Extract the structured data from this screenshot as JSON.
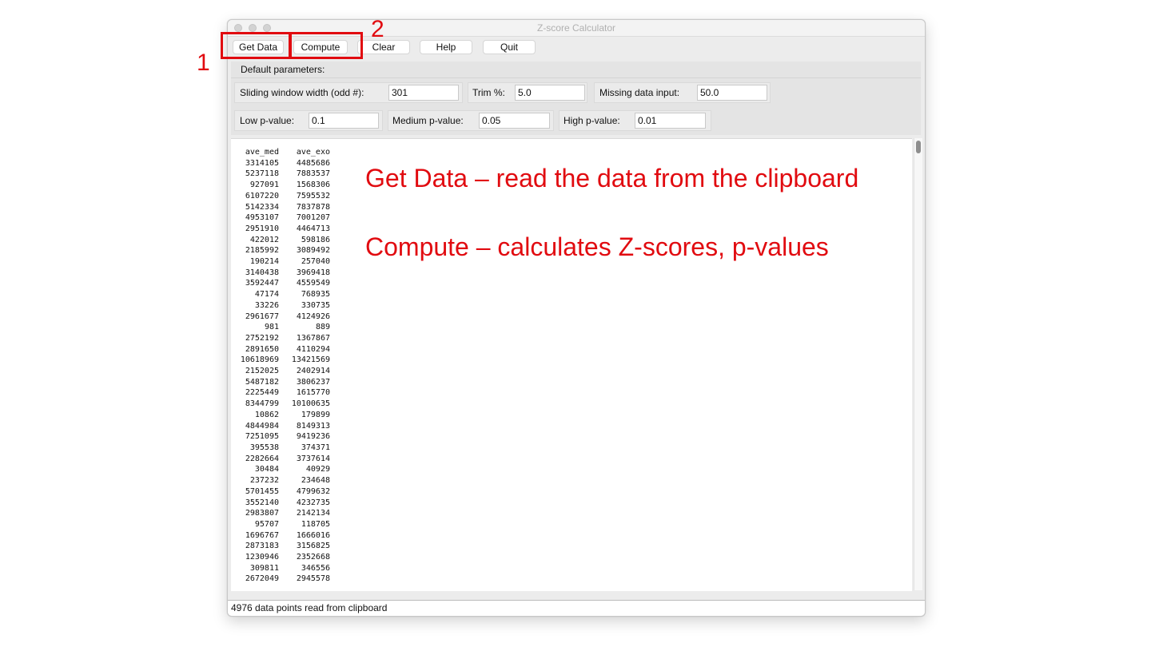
{
  "window": {
    "title": "Z-score Calculator"
  },
  "toolbar": {
    "get_data_label": "Get Data",
    "compute_label": "Compute",
    "clear_label": "Clear",
    "help_label": "Help",
    "quit_label": "Quit"
  },
  "params": {
    "section_title": "Default parameters:",
    "window_width_label": "Sliding window width (odd #):",
    "window_width_value": "301",
    "trim_label": "Trim %:",
    "trim_value": "5.0",
    "missing_label": "Missing data input:",
    "missing_value": "50.0",
    "low_label": "Low p-value:",
    "low_value": "0.1",
    "medium_label": "Medium p-value:",
    "medium_value": "0.05",
    "high_label": "High p-value:",
    "high_value": "0.01"
  },
  "data_table": {
    "headers": [
      "ave_med",
      "ave_exo"
    ],
    "col1": [
      "3314105",
      "5237118",
      "927091",
      "6107220",
      "5142334",
      "4953107",
      "2951910",
      "422012",
      "2185992",
      "190214",
      "3140438",
      "3592447",
      "47174",
      "33226",
      "2961677",
      "981",
      "2752192",
      "2891650",
      "10618969",
      "2152025",
      "5487182",
      "2225449",
      "8344799",
      "10862",
      "4844984",
      "7251095",
      "395538",
      "2282664",
      "30484",
      "237232",
      "5701455",
      "3552140",
      "2983807",
      "95707",
      "1696767",
      "2873183",
      "1230946",
      "309811",
      "2672049"
    ],
    "col2": [
      "4485686",
      "7883537",
      "1568306",
      "7595532",
      "7837878",
      "7001207",
      "4464713",
      "598186",
      "3089492",
      "257040",
      "3969418",
      "4559549",
      "768935",
      "330735",
      "4124926",
      "889",
      "1367867",
      "4110294",
      "13421569",
      "2402914",
      "3806237",
      "1615770",
      "10100635",
      "179899",
      "8149313",
      "9419236",
      "374371",
      "3737614",
      "40929",
      "234648",
      "4799632",
      "4232735",
      "2142134",
      "118705",
      "1666016",
      "3156825",
      "2352668",
      "346556",
      "2945578"
    ]
  },
  "status_text": "4976 data points read from clipboard",
  "annotations": {
    "step1": "1",
    "step2": "2",
    "get_data_note": "Get Data – read the data from the clipboard",
    "compute_note": "Compute – calculates Z-scores, p-values"
  },
  "colors": {
    "highlight_red": "#e10b10"
  }
}
